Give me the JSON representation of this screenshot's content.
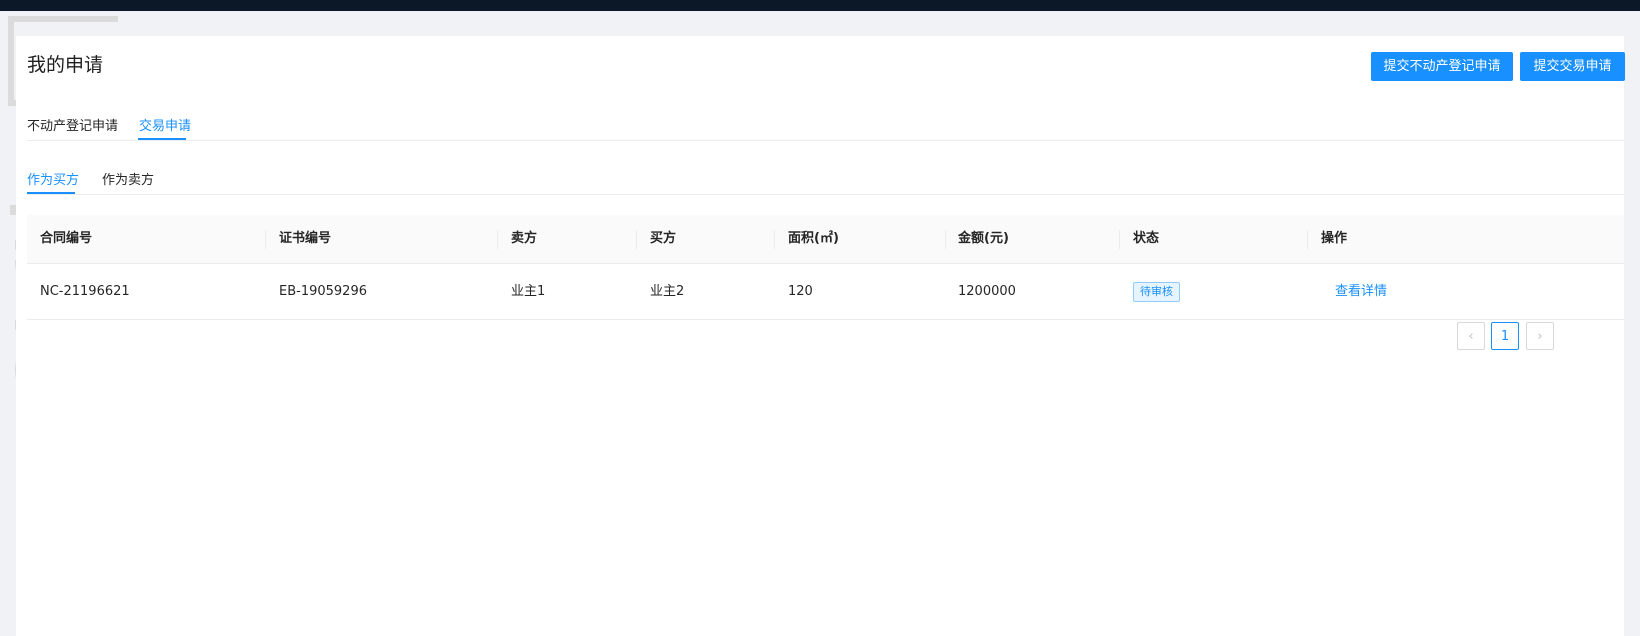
{
  "page": {
    "title": "我的申请",
    "buttons": {
      "submit_property": "提交不动产登记申请",
      "submit_trade": "提交交易申请"
    }
  },
  "main_tabs": [
    {
      "label": "不动产登记申请",
      "active": false
    },
    {
      "label": "交易申请",
      "active": true
    }
  ],
  "sub_tabs": [
    {
      "label": "作为买方",
      "active": true
    },
    {
      "label": "作为卖方",
      "active": false
    }
  ],
  "table": {
    "headers": {
      "contract_no": "合同编号",
      "cert_no": "证书编号",
      "seller": "卖方",
      "buyer": "买方",
      "area": "面积(㎡)",
      "amount": "金额(元)",
      "status": "状态",
      "action": "操作"
    },
    "rows": [
      {
        "contract_no": "NC-21196621",
        "cert_no": "EB-19059296",
        "seller": "业主1",
        "buyer": "业主2",
        "area": "120",
        "amount": "1200000",
        "status": "待审核",
        "action": "查看详情"
      }
    ]
  },
  "pagination": {
    "prev": "‹",
    "current": "1",
    "next": "›"
  },
  "colors": {
    "accent": "#1890ff",
    "topbar": "#0c1727"
  }
}
